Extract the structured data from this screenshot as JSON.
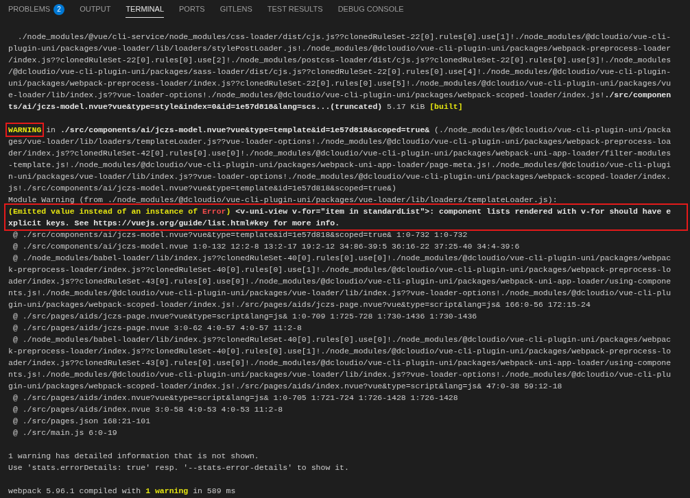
{
  "tabs": [
    {
      "label": "PROBLEMS",
      "badge": "2",
      "selected": false
    },
    {
      "label": "OUTPUT",
      "selected": false
    },
    {
      "label": "TERMINAL",
      "selected": true
    },
    {
      "label": "PORTS",
      "selected": false
    },
    {
      "label": "GITLENS",
      "selected": false
    },
    {
      "label": "TEST RESULTS",
      "selected": false
    },
    {
      "label": "DEBUG CONSOLE",
      "selected": false
    }
  ],
  "terminal_lines": [
    {
      "kind": "blank"
    },
    {
      "kind": "text",
      "boxed": false,
      "segments": [
        {
          "text": "  ./node_modules/@vue/cli-service/node_modules/css-loader/dist/cjs.js??clonedRuleSet-22[0].rules[0].use[1]!./node_modules/@dcloudio/vue-cli-",
          "kind": "plain"
        }
      ]
    },
    {
      "kind": "text",
      "boxed": false,
      "segments": [
        {
          "text": "plugin-uni/packages/vue-loader/lib/loaders/stylePostLoader.js!./node_modules/@dcloudio/vue-cli-plugin-uni/packages/webpack-preprocess-loader",
          "kind": "plain"
        }
      ]
    },
    {
      "kind": "text",
      "boxed": false,
      "segments": [
        {
          "text": "/index.js??clonedRuleSet-22[0].rules[0].use[2]!./node_modules/postcss-loader/dist/cjs.js??clonedRuleSet-22[0].rules[0].use[3]!./node_modules",
          "kind": "plain"
        }
      ]
    },
    {
      "kind": "text",
      "boxed": false,
      "segments": [
        {
          "text": "/@dcloudio/vue-cli-plugin-uni/packages/sass-loader/dist/cjs.js??clonedRuleSet-22[0].rules[0].use[4]!./node_modules/@dcloudio/vue-cli-plugin-",
          "kind": "plain"
        }
      ]
    },
    {
      "kind": "text",
      "boxed": false,
      "segments": [
        {
          "text": "uni/packages/webpack-preprocess-loader/index.js??clonedRuleSet-22[0].rules[0].use[5]!./node_modules/@dcloudio/vue-cli-plugin-uni/packages/vu",
          "kind": "plain"
        }
      ]
    },
    {
      "kind": "text",
      "boxed": false,
      "segments": [
        {
          "text": "e-loader/lib/index.js??vue-loader-options!./node_modules/@dcloudio/vue-cli-plugin-uni/packages/webpack-scoped-loader/index.js!",
          "kind": "plain"
        },
        {
          "text": "./src/componen",
          "kind": "path"
        }
      ]
    },
    {
      "kind": "text",
      "boxed": false,
      "segments": [
        {
          "text": "ts/ai/jczs-model.nvue?vue&type=style&index=0&id=1e57d818&lang=scs...(truncated)",
          "kind": "path"
        },
        {
          "text": " 5.17 KiB ",
          "kind": "plain"
        },
        {
          "text": "[built]",
          "kind": "warning"
        }
      ]
    },
    {
      "kind": "blank"
    },
    {
      "kind": "text",
      "boxed": false,
      "segments": [
        {
          "text": "WARNING",
          "kind": "warning",
          "boxed": true
        },
        {
          "text": " in ",
          "kind": "plain",
          "boxed": false
        },
        {
          "text": "./src/components/ai/jczs-model.nvue?vue&type=template&id=1e57d818&scoped=true&",
          "kind": "path",
          "boxed": false
        },
        {
          "text": " (./node_modules/@dcloudio/vue-cli-plugin-uni/packa",
          "kind": "plain",
          "boxed": false
        }
      ]
    },
    {
      "kind": "text",
      "boxed": false,
      "segments": [
        {
          "text": "ges/vue-loader/lib/loaders/templateLoader.js??vue-loader-options!./node_modules/@dcloudio/vue-cli-plugin-uni/packages/webpack-preprocess-loa",
          "kind": "plain"
        }
      ]
    },
    {
      "kind": "text",
      "boxed": false,
      "segments": [
        {
          "text": "der/index.js??clonedRuleSet-42[0].rules[0].use[0]!./node_modules/@dcloudio/vue-cli-plugin-uni/packages/webpack-uni-app-loader/filter-modules",
          "kind": "plain"
        }
      ]
    },
    {
      "kind": "text",
      "boxed": false,
      "segments": [
        {
          "text": "-template.js!./node_modules/@dcloudio/vue-cli-plugin-uni/packages/webpack-uni-app-loader/page-meta.js!./node_modules/@dcloudio/vue-cli-plugi",
          "kind": "plain"
        }
      ]
    },
    {
      "kind": "text",
      "boxed": false,
      "segments": [
        {
          "text": "n-uni/packages/vue-loader/lib/index.js??vue-loader-options!./node_modules/@dcloudio/vue-cli-plugin-uni/packages/webpack-scoped-loader/index.",
          "kind": "plain"
        }
      ]
    },
    {
      "kind": "text",
      "boxed": false,
      "segments": [
        {
          "text": "js!./src/components/ai/jczs-model.nvue?vue&type=template&id=1e57d818&scoped=true&)",
          "kind": "plain"
        }
      ]
    },
    {
      "kind": "text",
      "boxed": false,
      "segments": [
        {
          "text": "Module Warning (from ./node_modules/@dcloudio/vue-cli-plugin-uni/packages/vue-loader/lib/loaders/templateLoader.js):",
          "kind": "plain"
        }
      ]
    },
    {
      "kind": "text",
      "boxed": true,
      "segments": [
        {
          "text": "(Emitted value instead of an instance of ",
          "kind": "warning"
        },
        {
          "text": "Error",
          "kind": "error"
        },
        {
          "text": ")",
          "kind": "warning"
        },
        {
          "text": " <v-uni-view v-for=\"item in standardList\">: component lists rendered with v-for should have e",
          "kind": "path"
        }
      ]
    },
    {
      "kind": "text",
      "boxed": true,
      "segments": [
        {
          "text": "xplicit keys. See https://vuejs.org/guide/list.html#key for more info.",
          "kind": "path"
        }
      ]
    },
    {
      "kind": "text",
      "boxed": false,
      "segments": [
        {
          "text": " @ ./src/components/ai/jczs-model.nvue?vue&type=template&id=1e57d818&scoped=true& 1:0-732 1:0-732",
          "kind": "plain"
        }
      ]
    },
    {
      "kind": "text",
      "boxed": false,
      "segments": [
        {
          "text": " @ ./src/components/ai/jczs-model.nvue 1:0-132 12:2-8 13:2-17 19:2-12 34:86-39:5 36:16-22 37:25-40 34:4-39:6",
          "kind": "plain"
        }
      ]
    },
    {
      "kind": "text",
      "boxed": false,
      "segments": [
        {
          "text": " @ ./node_modules/babel-loader/lib/index.js??clonedRuleSet-40[0].rules[0].use[0]!./node_modules/@dcloudio/vue-cli-plugin-uni/packages/webpac",
          "kind": "plain"
        }
      ]
    },
    {
      "kind": "text",
      "boxed": false,
      "segments": [
        {
          "text": "k-preprocess-loader/index.js??clonedRuleSet-40[0].rules[0].use[1]!./node_modules/@dcloudio/vue-cli-plugin-uni/packages/webpack-preprocess-lo",
          "kind": "plain"
        }
      ]
    },
    {
      "kind": "text",
      "boxed": false,
      "segments": [
        {
          "text": "ader/index.js??clonedRuleSet-43[0].rules[0].use[0]!./node_modules/@dcloudio/vue-cli-plugin-uni/packages/webpack-uni-app-loader/using-compone",
          "kind": "plain"
        }
      ]
    },
    {
      "kind": "text",
      "boxed": false,
      "segments": [
        {
          "text": "nts.js!./node_modules/@dcloudio/vue-cli-plugin-uni/packages/vue-loader/lib/index.js??vue-loader-options!./node_modules/@dcloudio/vue-cli-plu",
          "kind": "plain"
        }
      ]
    },
    {
      "kind": "text",
      "boxed": false,
      "segments": [
        {
          "text": "gin-uni/packages/webpack-scoped-loader/index.js!./src/pages/aids/jczs-page.nvue?vue&type=script&lang=js& 166:0-56 172:15-24",
          "kind": "plain"
        }
      ]
    },
    {
      "kind": "text",
      "boxed": false,
      "segments": [
        {
          "text": " @ ./src/pages/aids/jczs-page.nvue?vue&type=script&lang=js& 1:0-709 1:725-728 1:730-1436 1:730-1436",
          "kind": "plain"
        }
      ]
    },
    {
      "kind": "text",
      "boxed": false,
      "segments": [
        {
          "text": " @ ./src/pages/aids/jczs-page.nvue 3:0-62 4:0-57 4:0-57 11:2-8",
          "kind": "plain"
        }
      ]
    },
    {
      "kind": "text",
      "boxed": false,
      "segments": [
        {
          "text": " @ ./node_modules/babel-loader/lib/index.js??clonedRuleSet-40[0].rules[0].use[0]!./node_modules/@dcloudio/vue-cli-plugin-uni/packages/webpac",
          "kind": "plain"
        }
      ]
    },
    {
      "kind": "text",
      "boxed": false,
      "segments": [
        {
          "text": "k-preprocess-loader/index.js??clonedRuleSet-40[0].rules[0].use[1]!./node_modules/@dcloudio/vue-cli-plugin-uni/packages/webpack-preprocess-lo",
          "kind": "plain"
        }
      ]
    },
    {
      "kind": "text",
      "boxed": false,
      "segments": [
        {
          "text": "ader/index.js??clonedRuleSet-43[0].rules[0].use[0]!./node_modules/@dcloudio/vue-cli-plugin-uni/packages/webpack-uni-app-loader/using-compone",
          "kind": "plain"
        }
      ]
    },
    {
      "kind": "text",
      "boxed": false,
      "segments": [
        {
          "text": "nts.js!./node_modules/@dcloudio/vue-cli-plugin-uni/packages/vue-loader/lib/index.js??vue-loader-options!./node_modules/@dcloudio/vue-cli-plu",
          "kind": "plain"
        }
      ]
    },
    {
      "kind": "text",
      "boxed": false,
      "segments": [
        {
          "text": "gin-uni/packages/webpack-scoped-loader/index.js!./src/pages/aids/index.nvue?vue&type=script&lang=js& 47:0-38 59:12-18",
          "kind": "plain"
        }
      ]
    },
    {
      "kind": "text",
      "boxed": false,
      "segments": [
        {
          "text": " @ ./src/pages/aids/index.nvue?vue&type=script&lang=js& 1:0-705 1:721-724 1:726-1428 1:726-1428",
          "kind": "plain"
        }
      ]
    },
    {
      "kind": "text",
      "boxed": false,
      "segments": [
        {
          "text": " @ ./src/pages/aids/index.nvue 3:0-58 4:0-53 4:0-53 11:2-8",
          "kind": "plain"
        }
      ]
    },
    {
      "kind": "text",
      "boxed": false,
      "segments": [
        {
          "text": " @ ./src/pages.json 168:21-101",
          "kind": "plain"
        }
      ]
    },
    {
      "kind": "text",
      "boxed": false,
      "segments": [
        {
          "text": " @ ./src/main.js 6:0-19",
          "kind": "plain"
        }
      ]
    },
    {
      "kind": "blank"
    },
    {
      "kind": "text",
      "boxed": false,
      "segments": [
        {
          "text": "1 warning has detailed information that is not shown.",
          "kind": "plain"
        }
      ]
    },
    {
      "kind": "text",
      "boxed": false,
      "segments": [
        {
          "text": "Use 'stats.errorDetails: true' resp. '--stats-error-details' to show it.",
          "kind": "plain"
        }
      ]
    },
    {
      "kind": "blank"
    },
    {
      "kind": "text",
      "boxed": false,
      "segments": [
        {
          "text": "webpack 5.96.1 compiled with ",
          "kind": "plain"
        },
        {
          "text": "1 warning",
          "kind": "warning"
        },
        {
          "text": " in 589 ms",
          "kind": "plain"
        }
      ]
    }
  ]
}
